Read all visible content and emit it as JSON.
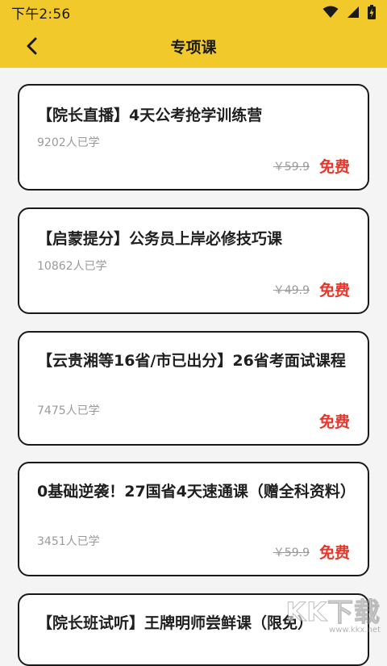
{
  "status_bar": {
    "time": "下午2:56",
    "icons": [
      "wifi-icon",
      "signal-icon",
      "battery-icon"
    ]
  },
  "header": {
    "back_icon": "chevron-left-icon",
    "title": "专项课"
  },
  "courses": [
    {
      "title": "【院长直播】4天公考抢学训练营",
      "learners": "9202人已学",
      "original_price": "￥59.9",
      "price": "免费"
    },
    {
      "title": "【启蒙提分】公务员上岸必修技巧课",
      "learners": "10862人已学",
      "original_price": "￥49.9",
      "price": "免费"
    },
    {
      "title": "【云贵湘等16省/市已出分】26省考面试课程",
      "learners": "7475人已学",
      "original_price": "",
      "price": "免费"
    },
    {
      "title": "0基础逆袭！27国省4天速通课（赠全科资料）",
      "learners": "3451人已学",
      "original_price": "￥59.9",
      "price": "免费"
    },
    {
      "title": "【院长班试听】王牌明师尝鲜课（限免）",
      "learners": "",
      "original_price": "",
      "price": ""
    }
  ],
  "watermark": {
    "main": "KK下载",
    "sub": "www.kkx.net"
  },
  "colors": {
    "accent": "#f2c92a",
    "free": "#e8362a",
    "muted": "#9a9a9a"
  }
}
